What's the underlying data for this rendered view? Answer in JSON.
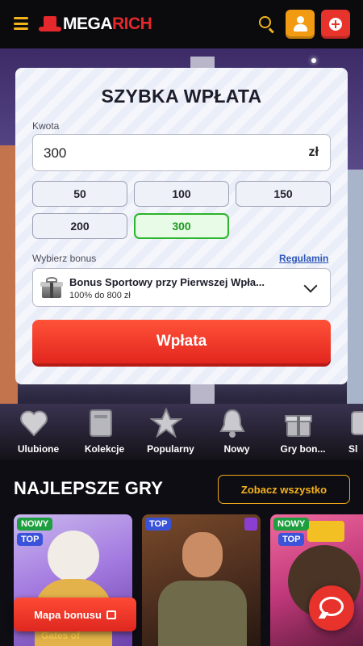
{
  "header": {
    "logo_part1": "MEGA",
    "logo_part2": "RICH"
  },
  "deposit": {
    "title": "SZYBKA WPŁATA",
    "amount_label": "Kwota",
    "amount_value": "300",
    "currency": "zł",
    "quick_amounts": [
      "50",
      "100",
      "150",
      "200",
      "300"
    ],
    "selected_amount": "300",
    "bonus_label": "Wybierz bonus",
    "terms_link": "Regulamin",
    "bonus_name": "Bonus Sportowy przy Pierwszej Wpła...",
    "bonus_detail": "100% do 800 zł",
    "submit_label": "Wpłata"
  },
  "categories": [
    {
      "label": "Ulubione",
      "icon": "heart-icon"
    },
    {
      "label": "Kolekcje",
      "icon": "book-icon"
    },
    {
      "label": "Popularny",
      "icon": "star-icon"
    },
    {
      "label": "Nowy",
      "icon": "bell-icon"
    },
    {
      "label": "Gry bon...",
      "icon": "gift-icon"
    },
    {
      "label": "Sl",
      "icon": "slot-icon"
    }
  ],
  "section": {
    "title": "NAJLEPSZE GRY",
    "see_all": "Zobacz wszystko"
  },
  "games": [
    {
      "badges": [
        "NOWY",
        "TOP"
      ],
      "caption": "Gates of"
    },
    {
      "badges": [
        "TOP"
      ],
      "caption": ""
    },
    {
      "badges": [
        "NOWY",
        "TOP"
      ],
      "caption": ""
    }
  ],
  "bonus_map": "Mapa bonusu",
  "colors": {
    "accent_red": "#e4282b",
    "accent_gold": "#f2b41a",
    "selected_green": "#2ab52a"
  }
}
